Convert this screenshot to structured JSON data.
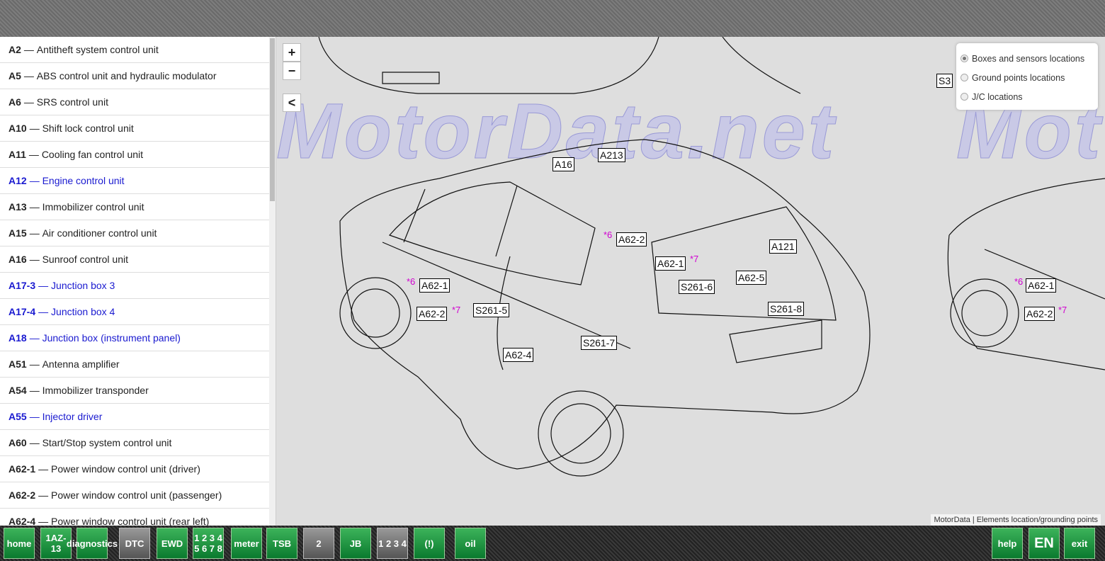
{
  "sidebar": {
    "items": [
      {
        "code": "A2",
        "name": "Antitheft system control unit",
        "link": false
      },
      {
        "code": "A5",
        "name": "ABS control unit and hydraulic modulator",
        "link": false
      },
      {
        "code": "A6",
        "name": "SRS control unit",
        "link": false
      },
      {
        "code": "A10",
        "name": "Shift lock control unit",
        "link": false
      },
      {
        "code": "A11",
        "name": "Cooling fan control unit",
        "link": false
      },
      {
        "code": "A12",
        "name": "Engine control unit",
        "link": true
      },
      {
        "code": "A13",
        "name": "Immobilizer control unit",
        "link": false
      },
      {
        "code": "A15",
        "name": "Air conditioner control unit",
        "link": false
      },
      {
        "code": "A16",
        "name": "Sunroof control unit",
        "link": false
      },
      {
        "code": "A17-3",
        "name": "Junction box 3",
        "link": true
      },
      {
        "code": "A17-4",
        "name": "Junction box 4",
        "link": true
      },
      {
        "code": "A18",
        "name": "Junction box (instrument panel)",
        "link": true
      },
      {
        "code": "A51",
        "name": "Antenna amplifier",
        "link": false
      },
      {
        "code": "A54",
        "name": "Immobilizer transponder",
        "link": false
      },
      {
        "code": "A55",
        "name": "Injector driver",
        "link": true
      },
      {
        "code": "A60",
        "name": "Start/Stop system control unit",
        "link": false
      },
      {
        "code": "A62-1",
        "name": "Power window control unit (driver)",
        "link": false
      },
      {
        "code": "A62-2",
        "name": "Power window control unit (passenger)",
        "link": false
      },
      {
        "code": "A62-4",
        "name": "Power window control unit (rear left)",
        "link": false
      }
    ],
    "separator": "—"
  },
  "map": {
    "zoom_in": "+",
    "zoom_out": "−",
    "collapse": "<",
    "watermark": "MotorData.net",
    "labels": [
      "A16",
      "A213",
      "A62-2",
      "A62-1",
      "A121",
      "A62-5",
      "S261-6",
      "S261-8",
      "A62-1",
      "A62-2",
      "S261-5",
      "A62-4",
      "S261-7",
      "S3",
      "A62-1",
      "A62-2"
    ],
    "notes": {
      "n6": "*6",
      "n7": "*7"
    },
    "legend": {
      "options": [
        "Boxes and sensors locations",
        "Ground points locations",
        "J/C locations"
      ],
      "selected": 0
    },
    "credit": "MotorData | Elements location/grounding points"
  },
  "toolbar": {
    "left": [
      "home",
      "1AZ-13",
      "diagnostics",
      "DTC",
      "EWD",
      "1 2 3 4 5 6 7 8",
      "meter",
      "TSB",
      "2",
      "JB",
      "1 2 3 4",
      "(!)",
      "oil"
    ],
    "right": [
      "help",
      "EN",
      "exit"
    ]
  },
  "colors": {
    "link": "#1a1ad0",
    "note": "#d000d0",
    "toolbar_green": "#0a7a2e"
  }
}
